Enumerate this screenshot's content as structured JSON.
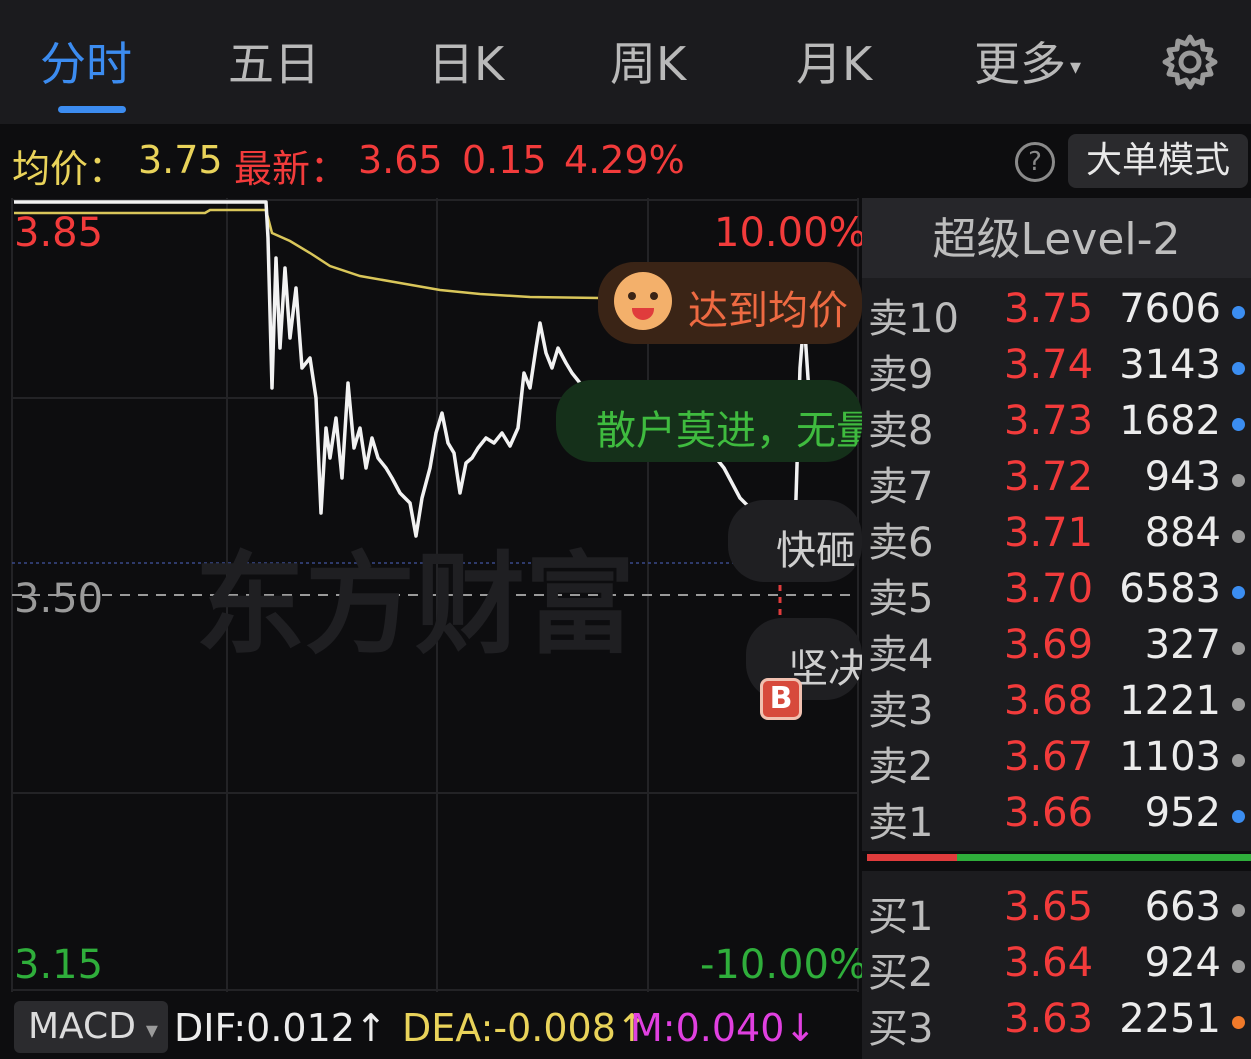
{
  "tabs": [
    {
      "label": "分时",
      "active": true
    },
    {
      "label": "五日",
      "active": false
    },
    {
      "label": "日K",
      "active": false
    },
    {
      "label": "周K",
      "active": false
    },
    {
      "label": "月K",
      "active": false
    },
    {
      "label": "更多",
      "active": false
    }
  ],
  "more_caret": "▾",
  "infobar": {
    "avg_label": "均价：",
    "avg_value": "3.75",
    "latest_label": "最新：",
    "latest_value": "3.65",
    "change": "0.15",
    "change_pct": "4.29%",
    "help_icon": "?",
    "mode_button": "大单模式"
  },
  "chart": {
    "price_high": "3.85",
    "price_mid": "3.50",
    "price_low": "3.15",
    "pct_high": "10.00%",
    "pct_low": "-10.00%",
    "watermark": "东方财富",
    "alert_text": "达到均价",
    "bubble_green": "散户莫进，无量",
    "bubble_gray1": "快砸",
    "bubble_gray2": "坚决",
    "buy_marker": "B",
    "colors": {
      "up": "#f23b3b",
      "down": "#2fae3b",
      "avg_line": "#d9c65a",
      "price_line": "#f2f2f2"
    }
  },
  "level2": {
    "title": "超级Level-2",
    "asks": [
      {
        "label": "卖10",
        "price": "3.75",
        "vol": "7606",
        "dot": "#3b8df0"
      },
      {
        "label": "卖9",
        "price": "3.74",
        "vol": "3143",
        "dot": "#3b8df0"
      },
      {
        "label": "卖8",
        "price": "3.73",
        "vol": "1682",
        "dot": "#3b8df0"
      },
      {
        "label": "卖7",
        "price": "3.72",
        "vol": "943",
        "dot": "#9a9a9a"
      },
      {
        "label": "卖6",
        "price": "3.71",
        "vol": "884",
        "dot": "#9a9a9a"
      },
      {
        "label": "卖5",
        "price": "3.70",
        "vol": "6583",
        "dot": "#3b8df0"
      },
      {
        "label": "卖4",
        "price": "3.69",
        "vol": "327",
        "dot": "#9a9a9a"
      },
      {
        "label": "卖3",
        "price": "3.68",
        "vol": "1221",
        "dot": "#9a9a9a"
      },
      {
        "label": "卖2",
        "price": "3.67",
        "vol": "1103",
        "dot": "#9a9a9a"
      },
      {
        "label": "卖1",
        "price": "3.66",
        "vol": "952",
        "dot": "#3b8df0"
      }
    ],
    "bids": [
      {
        "label": "买1",
        "price": "3.65",
        "vol": "663",
        "dot": "#9a9a9a"
      },
      {
        "label": "买2",
        "price": "3.64",
        "vol": "924",
        "dot": "#9a9a9a"
      },
      {
        "label": "买3",
        "price": "3.63",
        "vol": "2251",
        "dot": "#f07a2a"
      }
    ]
  },
  "macd": {
    "selector": "MACD",
    "caret": "▾",
    "dif": "DIF:0.012↑",
    "dea": "DEA:-0.008↑",
    "m": "M:0.040↓"
  }
}
